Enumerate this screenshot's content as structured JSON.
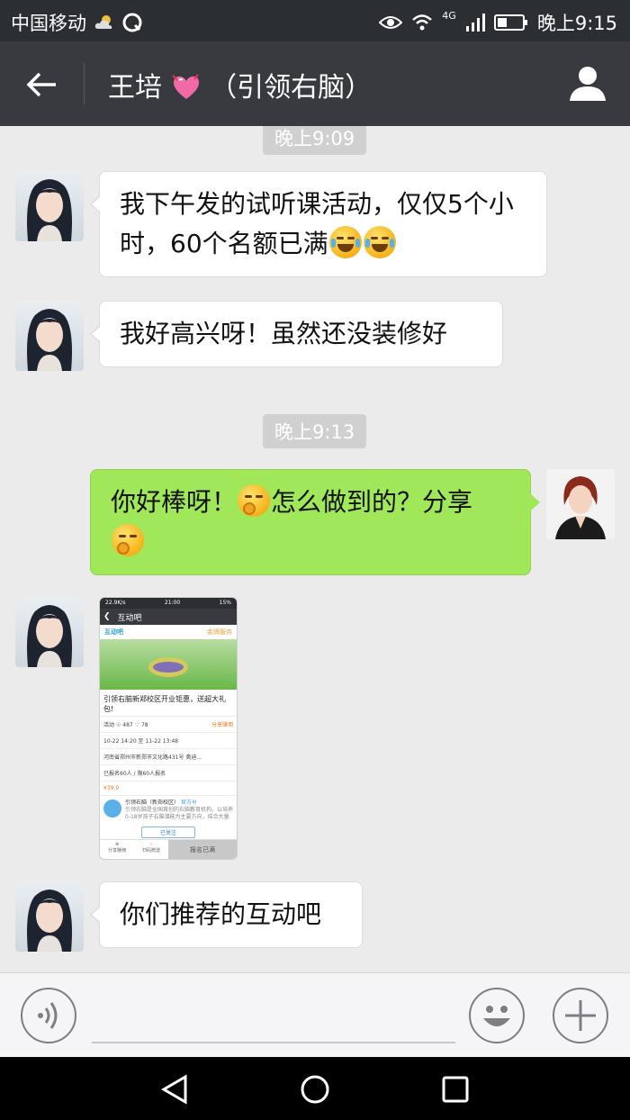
{
  "status_bar": {
    "carrier": "中国移动",
    "network": "4G",
    "time": "晚上9:15"
  },
  "header": {
    "title_name": "王培",
    "title_suffix": "（引领右脑）",
    "icons": [
      "back-arrow-icon",
      "heart-emoji",
      "profile-icon"
    ]
  },
  "messages": [
    {
      "type": "time",
      "text": "晚上9:09"
    },
    {
      "type": "text",
      "side": "left",
      "text": "我下午发的试听课活动，仅仅5个小时，60个名额已满",
      "emojis": [
        "laugh-cry-emoji",
        "laugh-cry-emoji"
      ]
    },
    {
      "type": "text",
      "side": "left",
      "text": "我好高兴呀！虽然还没装修好"
    },
    {
      "type": "time",
      "text": "晚上9:13"
    },
    {
      "type": "text",
      "side": "right",
      "text_a": "你好棒呀！",
      "text_b": "怎么做到的？分享",
      "emojis": [
        "giggle-emoji",
        "giggle-emoji"
      ]
    },
    {
      "type": "image",
      "side": "left"
    },
    {
      "type": "text",
      "side": "left",
      "text": "你们推荐的互动吧"
    }
  ],
  "image_message": {
    "status_left": "22.9K/s",
    "status_time": "21:00",
    "status_right": "15%",
    "header_title": "互动吧",
    "brand": "互动吧",
    "brand_right": "金牌服务",
    "event_title": "引领右脑新郑校区开业钜惠，送超大礼包!",
    "stats_left": "活动",
    "stats_views": "487",
    "stats_likes": "78",
    "stats_right": "分享赚佣",
    "time_row": "10-22 14:20 至 11-22 13:48",
    "address_row": "河南省郑州市新郑市文化路431号 奥迪...",
    "enroll_row": "已报名60人 / 限60人报名",
    "price_row": "¥39.9",
    "org_name": "引领右脑（新郑校区）",
    "org_badge": "官方号",
    "org_desc": "引领右脑是全国首创的右脑教育机构，以培养0-18岁孩子右脑潜能为主要方向，结合大量实践案例...",
    "follow_label": "已关注",
    "tab_1": "分享赚佣",
    "tab_2": "扫码赠送",
    "tab_3": "报名已满"
  },
  "input_bar": {
    "voice_icon": "voice-icon",
    "emoji_icon": "smiley-icon",
    "plus_icon": "plus-icon"
  },
  "nav_bar": {
    "icons": [
      "back-triangle-icon",
      "home-circle-icon",
      "recents-square-icon"
    ]
  }
}
